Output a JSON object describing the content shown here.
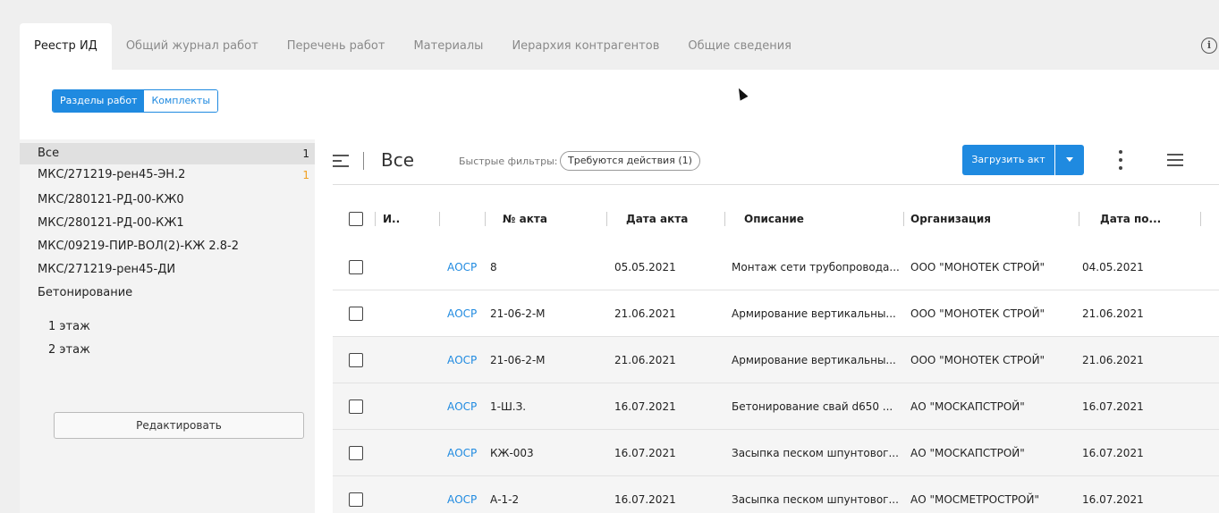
{
  "tabs": [
    {
      "label": "Реестр ИД",
      "active": true
    },
    {
      "label": "Общий журнал работ",
      "active": false
    },
    {
      "label": "Перечень работ",
      "active": false
    },
    {
      "label": "Материалы",
      "active": false
    },
    {
      "label": "Иерархия контрагентов",
      "active": false
    },
    {
      "label": "Общие сведения",
      "active": false
    }
  ],
  "info_icon": "i",
  "toggle": {
    "sections_label": "Разделы работ",
    "kits_label": "Комплекты"
  },
  "tree": {
    "items": [
      {
        "label": "Все",
        "count": "1",
        "selected": true
      },
      {
        "label": "МКС/271219-рен45-ЭН.2",
        "count": "1",
        "count_color": "#f0a020"
      },
      {
        "label": "МКС/280121-РД-00-КЖ0"
      },
      {
        "label": "МКС/280121-РД-00-КЖ1"
      },
      {
        "label": "МКС/09219-ПИР-ВОЛ(2)-КЖ 2.8-2"
      },
      {
        "label": "МКС/271219-рен45-ДИ"
      },
      {
        "label": "Бетонирование"
      },
      {
        "label": "1 этаж"
      },
      {
        "label": "2 этаж"
      }
    ],
    "edit_label": "Редактировать"
  },
  "toolbar": {
    "view_title": "Все",
    "quick_filters_label": "Быстрые фильтры:",
    "quick_filter_chip": "Требуются действия (1)",
    "upload_label": "Загрузить акт",
    "accent": "#1f8ae0"
  },
  "table": {
    "headers": [
      "И..",
      "№ акта",
      "Дата акта",
      "Описание",
      "Организация",
      "Дата по..."
    ],
    "rows": [
      {
        "type": "АОСР",
        "number": "8",
        "date": "05.05.2021",
        "description": "Монтаж сети трубопровода...",
        "org": "ООО \"МОНОТЕК СТРОЙ\"",
        "date2": "04.05.2021"
      },
      {
        "type": "АОСР",
        "number": "21-06-2-М",
        "date": "21.06.2021",
        "description": "Армирование вертикальны...",
        "org": "ООО \"МОНОТЕК СТРОЙ\"",
        "date2": "21.06.2021"
      },
      {
        "type": "АОСР",
        "number": "21-06-2-М",
        "date": "21.06.2021",
        "description": "Армирование вертикальны...",
        "org": "ООО \"МОНОТЕК СТРОЙ\"",
        "date2": "21.06.2021"
      },
      {
        "type": "АОСР",
        "number": "1-Ш.З.",
        "date": "16.07.2021",
        "description": "Бетонирование свай d650 ...",
        "org": "АО \"МОСКАПСТРОЙ\"",
        "date2": "16.07.2021"
      },
      {
        "type": "АОСР",
        "number": "КЖ-003",
        "date": "16.07.2021",
        "description": "Засыпка песком шпунтовог...",
        "org": "АО \"МОСКАПСТРОЙ\"",
        "date2": "16.07.2021"
      },
      {
        "type": "АОСР",
        "number": "А-1-2",
        "date": "16.07.2021",
        "description": "Засыпка песком шпунтовог...",
        "org": "АО \"МОСМЕТРОСТРОЙ\"",
        "date2": "16.07.2021"
      }
    ]
  }
}
